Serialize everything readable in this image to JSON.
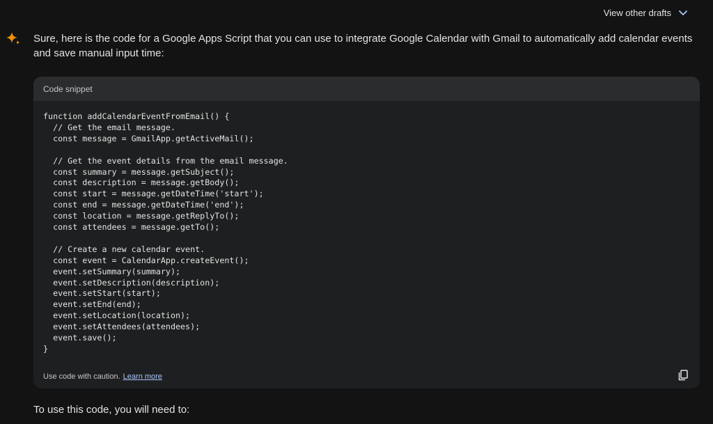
{
  "header": {
    "drafts_label": "View other drafts",
    "drafts_icon": "chevron-down-icon"
  },
  "response": {
    "avatar_icon": "gemini-sparkle-icon",
    "intro": "Sure, here is the code for a Google Apps Script that you can use to integrate Google Calendar with Gmail to automatically add calendar events and save manual input time:",
    "followup": "To use this code, you will need to:"
  },
  "code_block": {
    "title": "Code snippet",
    "lines": [
      "function addCalendarEventFromEmail() {",
      "  // Get the email message.",
      "  const message = GmailApp.getActiveMail();",
      "",
      "  // Get the event details from the email message.",
      "  const summary = message.getSubject();",
      "  const description = message.getBody();",
      "  const start = message.getDateTime('start');",
      "  const end = message.getDateTime('end');",
      "  const location = message.getReplyTo();",
      "  const attendees = message.getTo();",
      "",
      "  // Create a new calendar event.",
      "  const event = CalendarApp.createEvent();",
      "  event.setSummary(summary);",
      "  event.setDescription(description);",
      "  event.setStart(start);",
      "  event.setEnd(end);",
      "  event.setLocation(location);",
      "  event.setAttendees(attendees);",
      "  event.save();",
      "}"
    ],
    "caution_text": "Use code with caution.",
    "learn_more": "Learn more",
    "copy_icon": "copy-icon"
  },
  "colors": {
    "background": "#131314",
    "card": "#1e1f20",
    "card_header": "#2b2c2e",
    "link": "#a8c7fa",
    "sparkle_blue": "#4285f4",
    "sparkle_orange": "#f29900"
  }
}
